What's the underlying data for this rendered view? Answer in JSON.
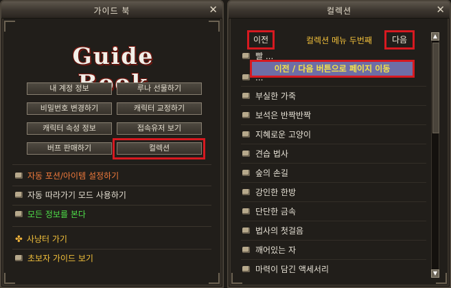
{
  "guide_window": {
    "title": "가이드 북",
    "logo_text": "Guide Book",
    "buttons": [
      "내 계정 정보",
      "루나 선물하기",
      "비밀번호 변경하기",
      "캐릭터 교정하기",
      "캐릭터 속성 정보",
      "접속유저 보기",
      "버프 판매하기",
      "컬렉션"
    ],
    "menu": [
      {
        "label": "자동 포션/아이템 설정하기",
        "color": "#f07a3c"
      },
      {
        "label": "자동 따라가기 모드 사용하기",
        "color": "#e3ddd0"
      },
      {
        "label": "모든 정보를 본다",
        "color": "#4fe04a"
      },
      {
        "label": "사냥터 가기",
        "color": "#f3c13b"
      },
      {
        "label": "초보자 가이드 보기",
        "color": "#f3c13b"
      }
    ],
    "highlight_color": "#d71920"
  },
  "collection_window": {
    "title": "컬렉션",
    "prev_label": "이전",
    "next_label": "다음",
    "page_title": "컬렉션 메뉴 두번째",
    "annotation": "이전 / 다음 버튼으로 페이지 이동",
    "items": [
      "빨 ...",
      "...",
      "부실한 가죽",
      "보석은 반짝반짝",
      "지혜로운 고양이",
      "견습 법사",
      "숲의 손길",
      "강인한 한방",
      "단단한 금속",
      "법사의 첫걸음",
      "깨어있는 자",
      "마력이 담긴 액세서리"
    ]
  }
}
